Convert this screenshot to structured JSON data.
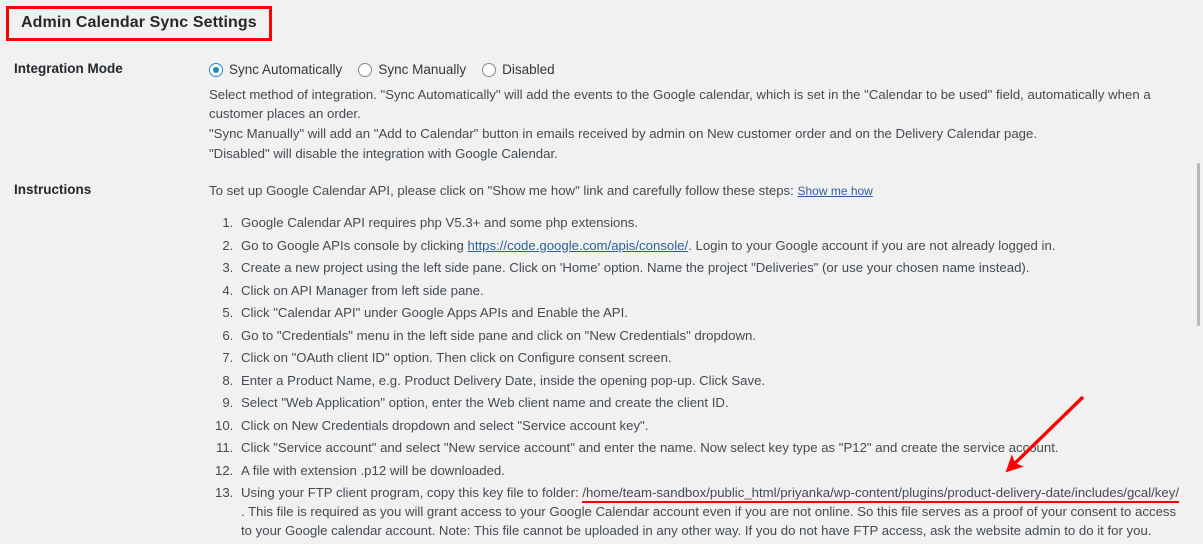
{
  "page_title": "Admin Calendar Sync Settings",
  "colors": {
    "background": "#f1f1f1",
    "annotation_red": "#ff0000",
    "link_blue": "#2d5f9a",
    "radio_accent": "#1e8cbe",
    "text": "#444b52"
  },
  "rows": {
    "integration_mode": {
      "label": "Integration Mode",
      "options": [
        {
          "label": "Sync Automatically",
          "checked": true
        },
        {
          "label": "Sync Manually",
          "checked": false
        },
        {
          "label": "Disabled",
          "checked": false
        }
      ],
      "desc1": "Select method of integration. \"Sync Automatically\" will add the events to the Google calendar, which is set in the \"Calendar to be used\" field, automatically when a customer places an order.",
      "desc2": "\"Sync Manually\" will add an \"Add to Calendar\" button in emails received by admin on New customer order and on the Delivery Calendar page.",
      "desc3": "\"Disabled\" will disable the integration with Google Calendar."
    },
    "instructions": {
      "label": "Instructions",
      "intro_text": "To set up Google Calendar API, please click on \"Show me how\" link and carefully follow these steps: ",
      "intro_link": "Show me how",
      "steps": [
        {
          "text": "Google Calendar API requires php V5.3+ and some php extensions."
        },
        {
          "before": "Go to Google APIs console by clicking ",
          "link": "https://code.google.com/apis/console/",
          "after": ". Login to your Google account if you are not already logged in."
        },
        {
          "text": "Create a new project using the left side pane. Click on 'Home' option. Name the project \"Deliveries\" (or use your chosen name instead)."
        },
        {
          "text": "Click on API Manager from left side pane."
        },
        {
          "text": "Click \"Calendar API\" under Google Apps APIs and Enable the API."
        },
        {
          "text": "Go to \"Credentials\" menu in the left side pane and click on \"New Credentials\" dropdown."
        },
        {
          "text": "Click on \"OAuth client ID\" option. Then click on Configure consent screen."
        },
        {
          "text": "Enter a Product Name, e.g. Product Delivery Date, inside the opening pop-up. Click Save."
        },
        {
          "text": "Select \"Web Application\" option, enter the Web client name and create the client ID."
        },
        {
          "text": "Click on New Credentials dropdown and select \"Service account key\"."
        },
        {
          "text": "Click \"Service account\" and select \"New service account\" and enter the name. Now select key type as \"P12\" and create the service account."
        },
        {
          "text": "A file with extension .p12 will be downloaded."
        },
        {
          "before": "Using your FTP client program, copy this key file to folder: ",
          "highlight": "/home/team-sandbox/public_html/priyanka/wp-content/plugins/product-delivery-date/includes/gcal/key/",
          "after": " . This file is required as you will grant access to your Google Calendar account even if you are not online. So this file serves as a proof of your consent to access to your Google calendar account. Note: This file cannot be uploaded in any other way. If you do not have FTP access, ask the website admin to do it for you."
        }
      ]
    }
  }
}
